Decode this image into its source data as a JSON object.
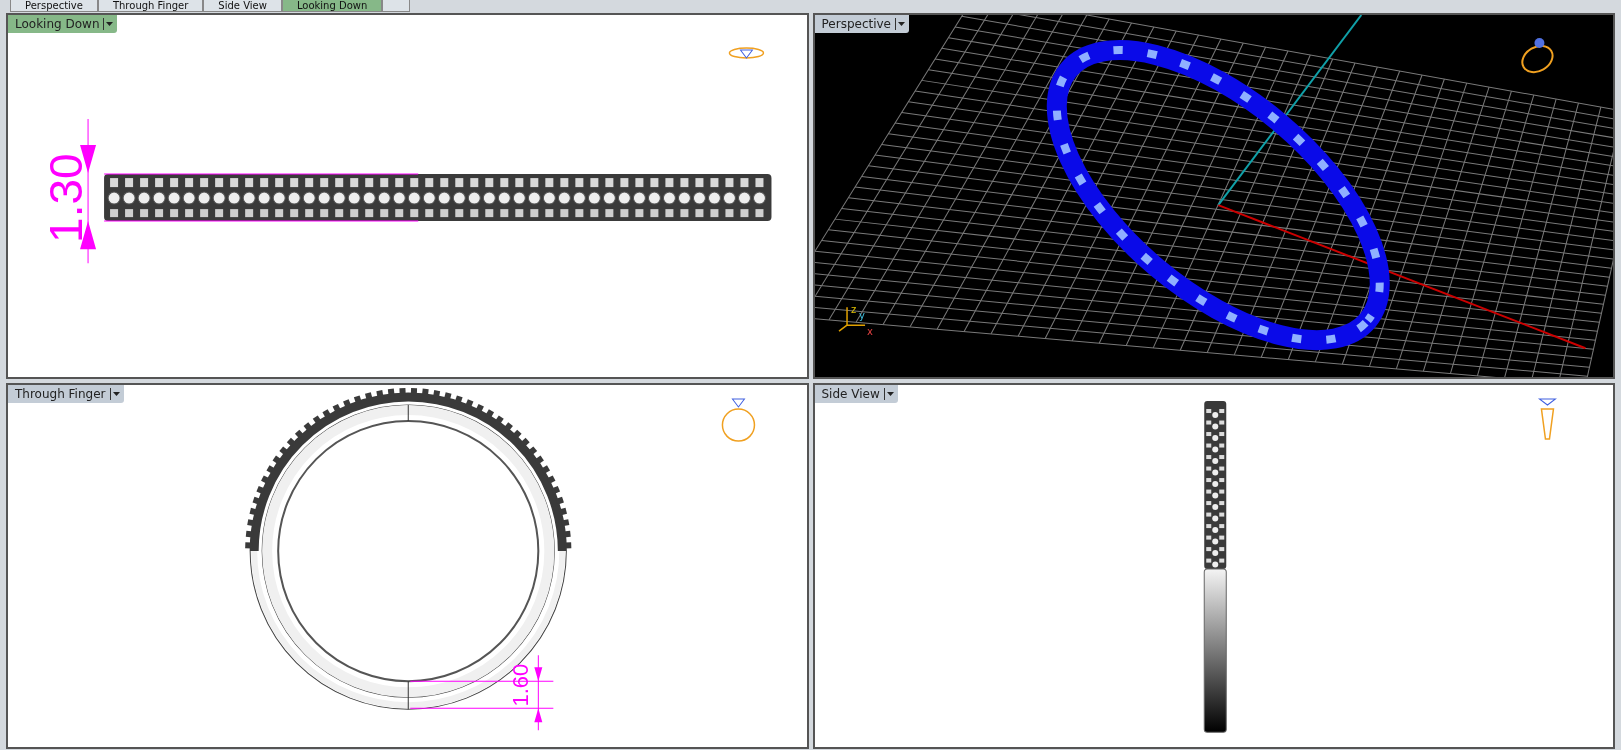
{
  "tabs": [
    {
      "label": "Perspective",
      "selected": false
    },
    {
      "label": "Through Finger",
      "selected": false
    },
    {
      "label": "Side View",
      "selected": false
    },
    {
      "label": "Looking Down",
      "selected": true
    }
  ],
  "viewports": [
    {
      "title": "Looking Down",
      "selected": true,
      "kind": "top",
      "dimension": "1.30"
    },
    {
      "title": "Perspective",
      "selected": false,
      "kind": "perspective",
      "axis_labels": [
        "z",
        "y",
        "x"
      ]
    },
    {
      "title": "Through Finger",
      "selected": false,
      "kind": "front",
      "dimension": "1.60"
    },
    {
      "title": "Side View",
      "selected": false,
      "kind": "side"
    }
  ]
}
